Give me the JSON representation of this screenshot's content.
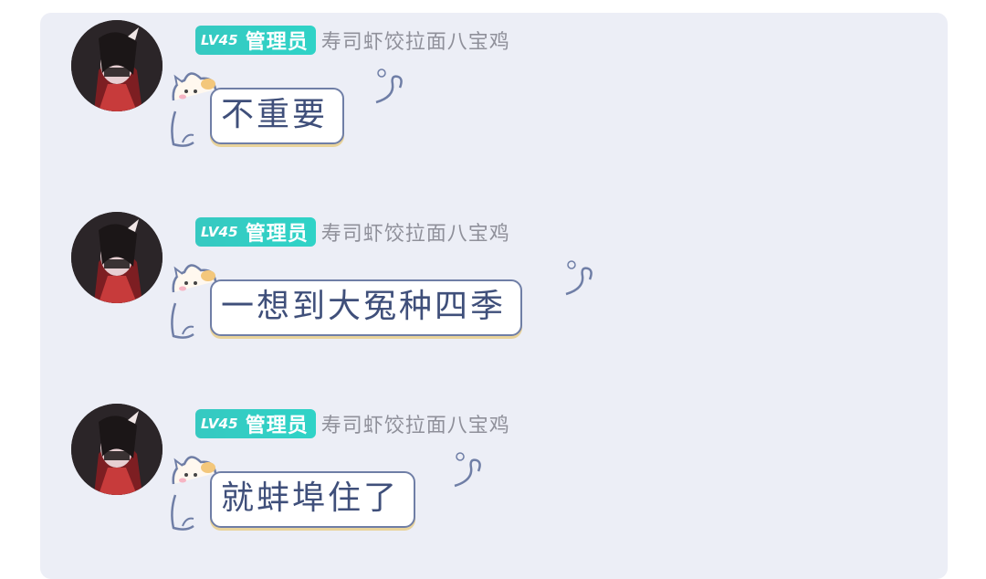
{
  "messages": [
    {
      "level": "LV45",
      "role": "管理员",
      "nickname": "寿司虾饺拉面八宝鸡",
      "text": "不重要"
    },
    {
      "level": "LV45",
      "role": "管理员",
      "nickname": "寿司虾饺拉面八宝鸡",
      "text": "一想到大冤种四季"
    },
    {
      "level": "LV45",
      "role": "管理员",
      "nickname": "寿司虾饺拉面八宝鸡",
      "text": "就蚌埠住了"
    }
  ],
  "colors": {
    "panel_bg": "#eceef6",
    "badge": "#36c9c1",
    "nickname": "#8f909a",
    "bubble_border": "#6f7ea6",
    "bubble_text": "#3f4f7a"
  }
}
